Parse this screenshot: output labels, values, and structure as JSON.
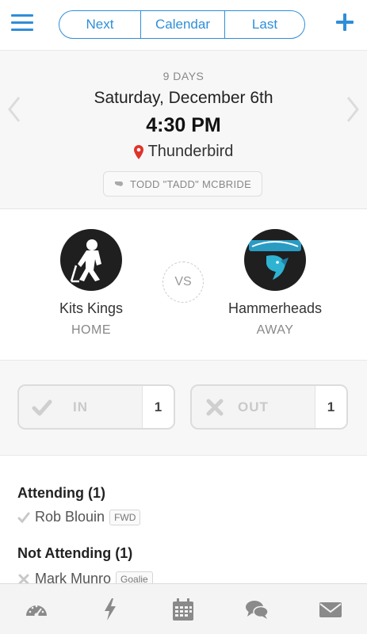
{
  "header": {
    "menu_icon": "hamburger-menu-icon",
    "segments": [
      "Next",
      "Calendar",
      "Last"
    ],
    "add_icon": "plus-icon"
  },
  "game": {
    "days_until": "9 DAYS",
    "date": "Saturday, December 6th",
    "time": "4:30 PM",
    "location": "Thunderbird",
    "referee": "TODD \"TADD\" MCBRIDE"
  },
  "teams": {
    "home": {
      "name": "Kits Kings",
      "side": "HOME"
    },
    "vs": "VS",
    "away": {
      "name": "Hammerheads",
      "side": "AWAY"
    }
  },
  "attendance": {
    "in_label": "IN",
    "in_count": "1",
    "out_label": "OUT",
    "out_count": "1"
  },
  "lists": {
    "attending_title": "Attending (1)",
    "attending": [
      {
        "name": "Rob Blouin",
        "position": "FWD"
      }
    ],
    "not_attending_title": "Not Attending (1)",
    "not_attending": [
      {
        "name": "Mark Munro",
        "position": "Goalie"
      }
    ]
  },
  "tabbar": {
    "icons": [
      "dashboard-icon",
      "lightning-icon",
      "calendar-icon",
      "chat-icon",
      "mail-icon"
    ]
  },
  "colors": {
    "accent": "#2f8ed8",
    "pin": "#e0332a"
  }
}
